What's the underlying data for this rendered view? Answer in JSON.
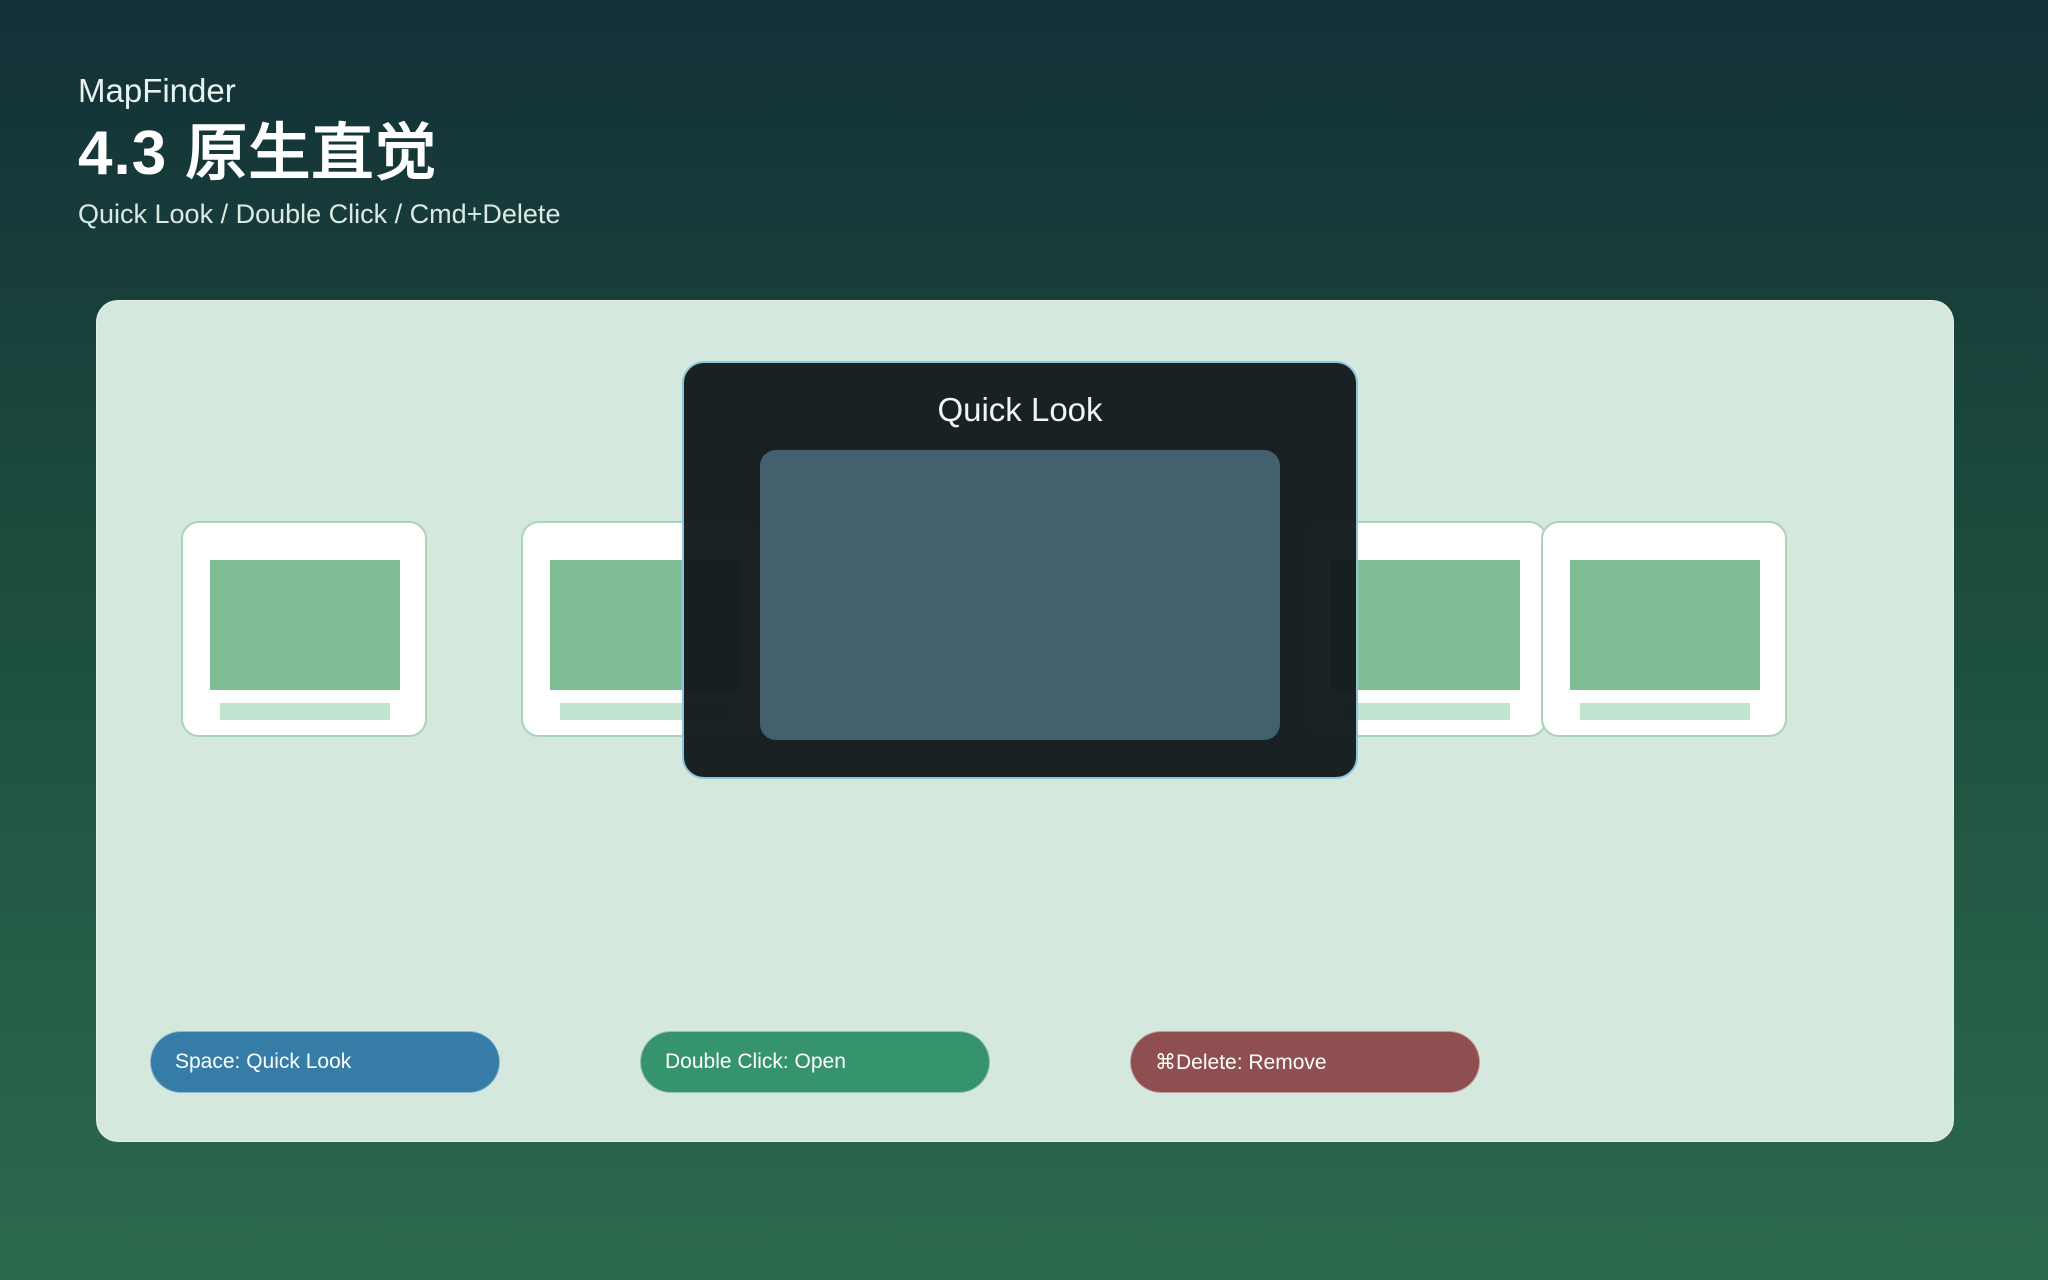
{
  "header": {
    "app_name": "MapFinder",
    "title": "4.3 原生直觉",
    "subtitle": "Quick Look / Double Click / Cmd+Delete"
  },
  "quick_look": {
    "title": "Quick Look"
  },
  "shortcuts": [
    {
      "label": "Space: Quick Look",
      "color": "#357ca6"
    },
    {
      "label": "Double Click: Open",
      "color": "#35946b"
    },
    {
      "label": "⌘Delete: Remove",
      "color": "#8f4e4f"
    }
  ],
  "colors": {
    "panel_background": "#d5e8de",
    "thumbnail_image": "#7fbe94",
    "quick_look_frame": "#8fc6dc",
    "quick_look_preview": "#43606f"
  }
}
